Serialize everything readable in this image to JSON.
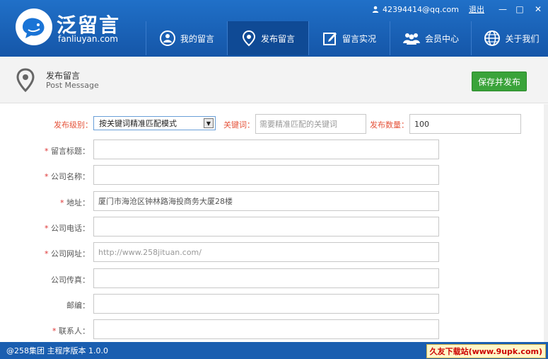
{
  "app": {
    "logo_title": "泛留言",
    "logo_sub": "fanliuyan.com"
  },
  "topbar": {
    "email": "42394414@qq.com",
    "logout": "退出",
    "minimize": "—",
    "maximize": "□",
    "close": "✕"
  },
  "nav": [
    {
      "label": "我的留言",
      "icon": "user-chat-icon"
    },
    {
      "label": "发布留言",
      "icon": "location-pin-icon",
      "active": true
    },
    {
      "label": "留言实况",
      "icon": "edit-icon"
    },
    {
      "label": "会员中心",
      "icon": "members-icon"
    },
    {
      "label": "关于我们",
      "icon": "globe-icon"
    }
  ],
  "page": {
    "title": "发布留言",
    "subtitle": "Post Message",
    "publish_button": "保存并发布"
  },
  "form": {
    "level_label": "发布级别：",
    "level_value": "按关键词精准匹配模式",
    "keyword_label": "关键词：",
    "keyword_placeholder": "需要精准匹配的关键词",
    "count_label": "发布数量：",
    "count_value": "100",
    "fields": [
      {
        "label": "留言标题：",
        "required": true,
        "value": ""
      },
      {
        "label": "公司名称：",
        "required": true,
        "value": ""
      },
      {
        "label": "地址：",
        "required": true,
        "value": "厦门市海沧区钟林路海投商务大厦28楼"
      },
      {
        "label": "公司电话：",
        "required": true,
        "value": ""
      },
      {
        "label": "公司网址：",
        "required": true,
        "value": "http://www.258jituan.com/"
      },
      {
        "label": "公司传真：",
        "required": false,
        "value": ""
      },
      {
        "label": "邮编：",
        "required": false,
        "value": ""
      },
      {
        "label": "联系人：",
        "required": true,
        "value": ""
      }
    ]
  },
  "footer": {
    "version": "@258集团 主程序版本 1.0.0",
    "watermark": "久友下载站(www.9upk.com)"
  }
}
